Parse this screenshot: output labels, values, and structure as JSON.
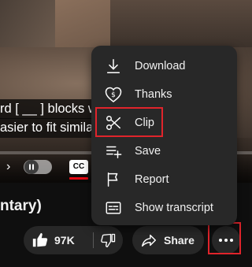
{
  "video": {
    "captions": {
      "line1": "rd [ __ ] blocks w",
      "line2": "asier to fit simila"
    },
    "controls": {
      "next_glyph": "›",
      "cc_label": "CC"
    }
  },
  "title": "ntary)",
  "actions": {
    "like_count": "97K",
    "share_label": "Share"
  },
  "menu": {
    "items": [
      {
        "label": "Download",
        "icon": "download-icon"
      },
      {
        "label": "Thanks",
        "icon": "thanks-heart-dollar-icon"
      },
      {
        "label": "Clip",
        "icon": "scissors-icon"
      },
      {
        "label": "Save",
        "icon": "add-to-playlist-icon"
      },
      {
        "label": "Report",
        "icon": "flag-icon"
      },
      {
        "label": "Show transcript",
        "icon": "transcript-icon"
      }
    ]
  },
  "colors": {
    "highlight": "#e0242b",
    "cc_active": "#e50914",
    "menu_bg": "#282828",
    "page_bg": "#0f0f0f"
  }
}
